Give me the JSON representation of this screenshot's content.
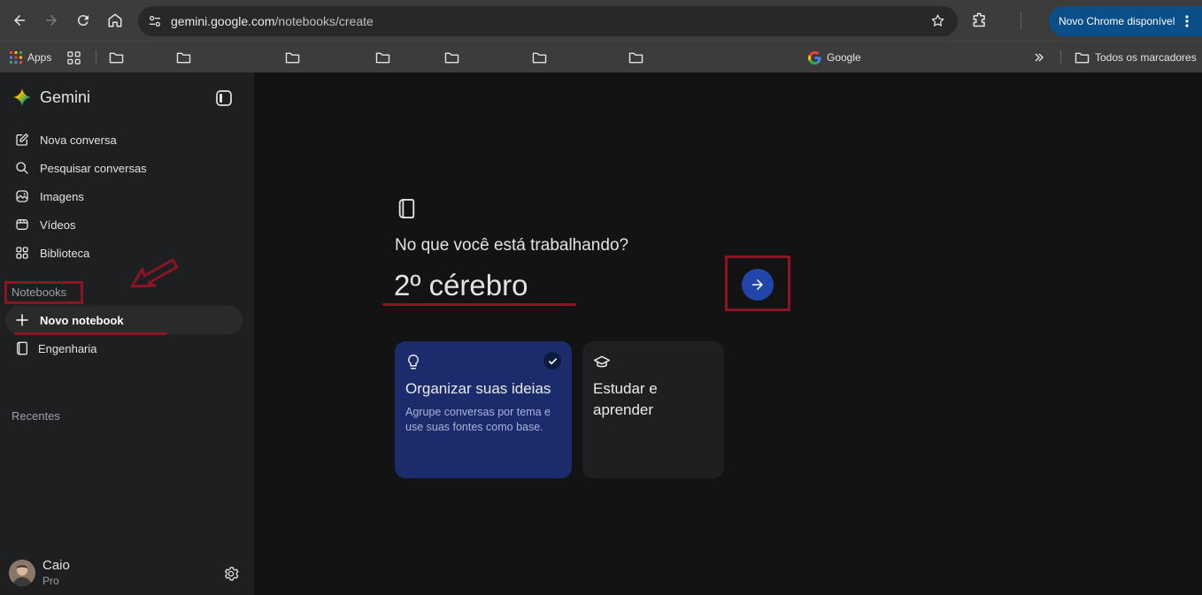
{
  "browser": {
    "url_host": "gemini.google.com",
    "url_path": "/notebooks/create",
    "update_label": "Novo Chrome disponível"
  },
  "bookmarks": {
    "apps_label": "Apps",
    "google_label": "Google",
    "all_bookmarks_label": "Todos os marcadores"
  },
  "sidebar": {
    "brand": "Gemini",
    "items": [
      {
        "label": "Nova conversa"
      },
      {
        "label": "Pesquisar conversas"
      },
      {
        "label": "Imagens"
      },
      {
        "label": "Vídeos"
      },
      {
        "label": "Biblioteca"
      }
    ],
    "notebooks_label": "Notebooks",
    "new_notebook_label": "Novo notebook",
    "notebooks": [
      {
        "label": "Engenharia"
      }
    ],
    "recent_label": "Recentes",
    "user": {
      "name": "Caio",
      "plan": "Pro"
    }
  },
  "main": {
    "prompt": "No que você está trabalhando?",
    "title_value": "2º cérebro",
    "cards": [
      {
        "title": "Organizar suas ideias",
        "desc": "Agrupe conversas por tema e use suas fontes como base.",
        "selected": true
      },
      {
        "title": "Estudar e aprender",
        "desc": "",
        "selected": false
      }
    ]
  },
  "colors": {
    "accent": "#2145a8",
    "annotation": "#8b1522",
    "selected_card": "#1c2b6b"
  },
  "icons": [
    "back-icon",
    "forward-icon",
    "reload-icon",
    "home-icon",
    "site-settings-icon",
    "star-icon",
    "extensions-icon",
    "more-vert-icon",
    "apps-grid-icon",
    "folder-icon",
    "google-icon",
    "chevron-double-right-icon",
    "gemini-logo-icon",
    "sidebar-toggle-icon",
    "edit-icon",
    "search-icon",
    "image-icon",
    "video-icon",
    "library-icon",
    "plus-icon",
    "notebook-icon",
    "settings-icon",
    "arrow-right-icon",
    "lightbulb-icon",
    "check-icon",
    "graduation-cap-icon"
  ]
}
